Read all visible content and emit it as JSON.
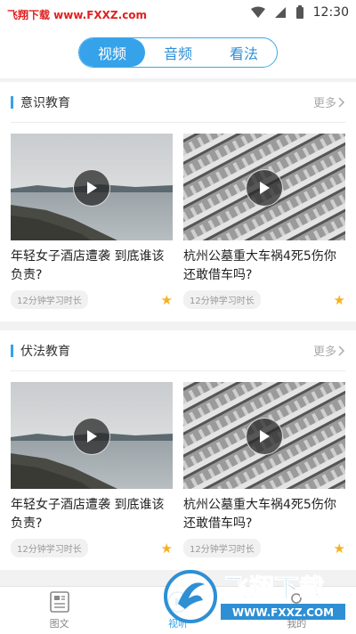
{
  "status_bar": {
    "watermark": "飞翔下载 www.FXXZ.com",
    "time": "12:30"
  },
  "tabs": [
    {
      "label": "视频"
    },
    {
      "label": "音频"
    },
    {
      "label": "看法"
    }
  ],
  "sections": [
    {
      "title": "意识教育",
      "more": "更多",
      "cards": [
        {
          "title": "年轻女子酒店遭袭 到底谁该负责?",
          "tag": "12分钟学习时长"
        },
        {
          "title": "杭州公墓重大车祸4死5伤你还敢借车吗?",
          "tag": "12分钟学习时长"
        }
      ]
    },
    {
      "title": "伏法教育",
      "more": "更多",
      "cards": [
        {
          "title": "年轻女子酒店遭袭 到底谁该负责?",
          "tag": "12分钟学习时长"
        },
        {
          "title": "杭州公墓重大车祸4死5伤你还敢借车吗?",
          "tag": "12分钟学习时长"
        }
      ]
    }
  ],
  "bottom_nav": [
    {
      "label": "图文",
      "icon": "document-icon"
    },
    {
      "label": "视听",
      "icon": "play-icon"
    },
    {
      "label": "我的",
      "icon": "user-icon"
    }
  ],
  "bottom_watermark": {
    "title": "飞翔下载",
    "url": "WWW.FXXZ.COM"
  },
  "colors": {
    "accent": "#36a2ea",
    "star": "#f5b123",
    "watermark": "#e02020"
  }
}
